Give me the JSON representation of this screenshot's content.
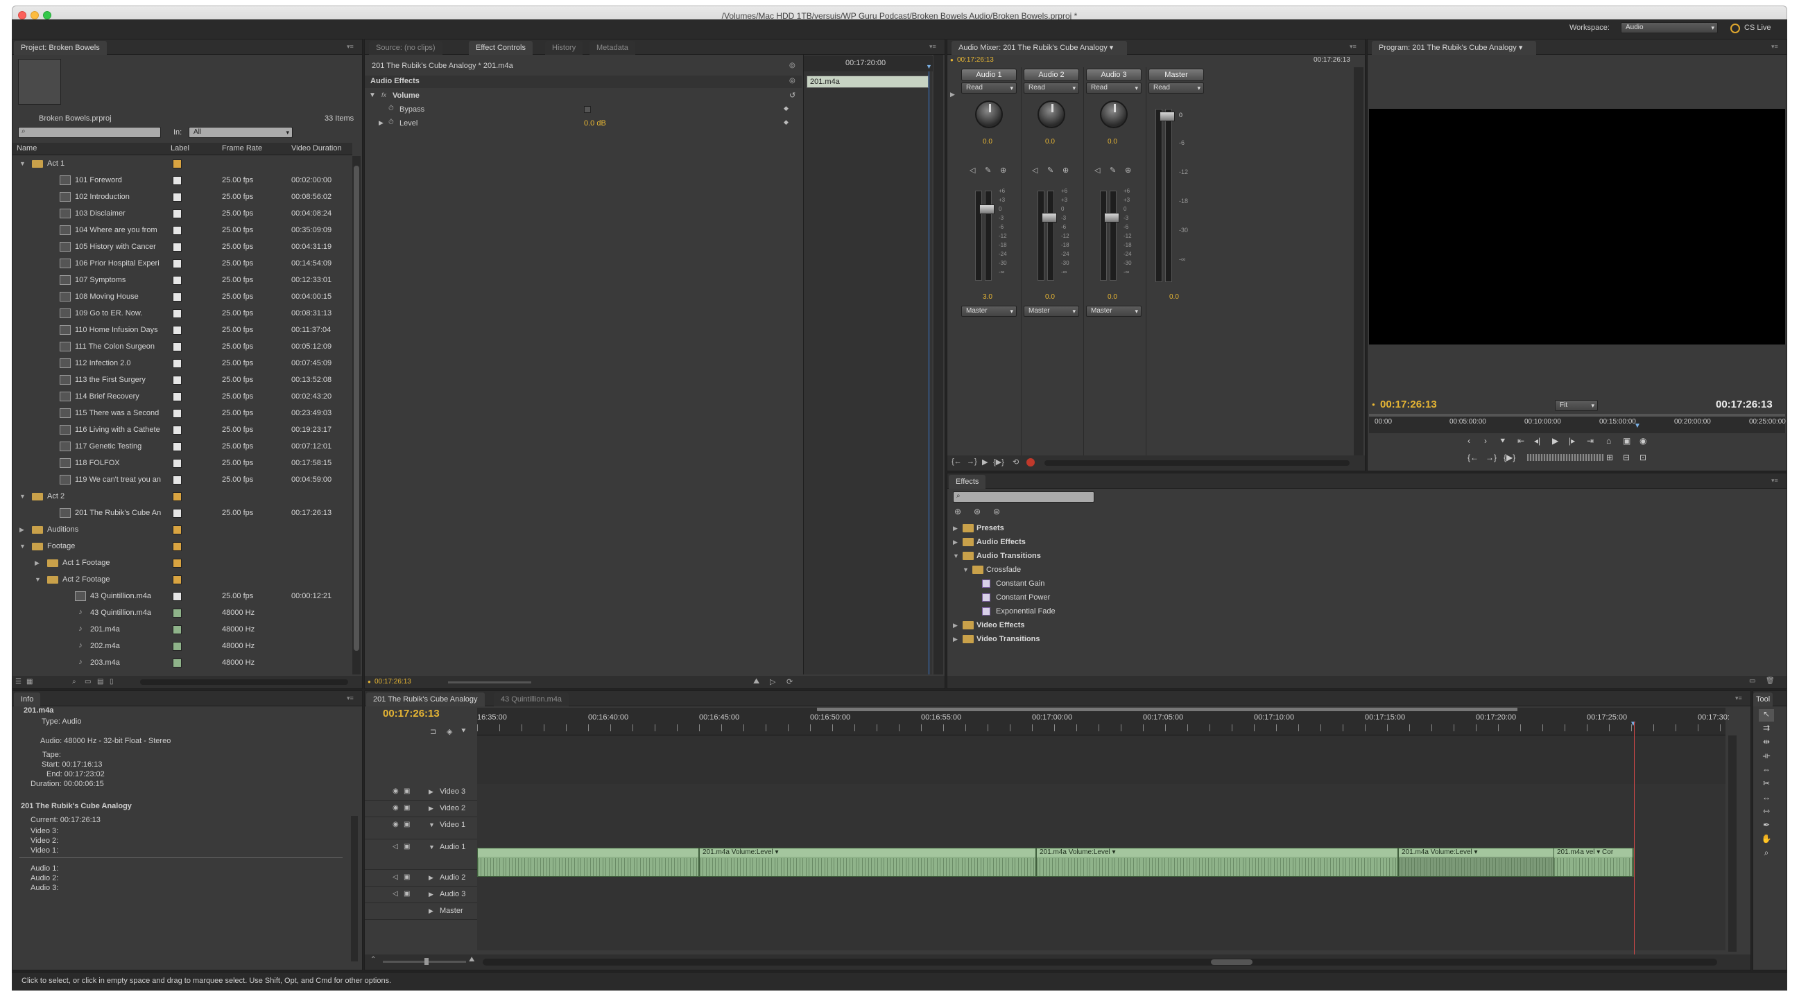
{
  "window": {
    "title": "/Volumes/Mac HDD 1TB/versuis/WP Guru Podcast/Broken Bowels Audio/Broken Bowels.prproj *"
  },
  "workspace": {
    "label": "Workspace:",
    "value": "Audio",
    "cs_live": "CS Live"
  },
  "project": {
    "tab": "Project: Broken Bowels",
    "filename": "Broken Bowels.prproj",
    "items_count": "33 Items",
    "in_label": "In:",
    "in_value": "All",
    "columns": [
      "Name",
      "Label",
      "Frame Rate",
      "Video Duration"
    ],
    "rows": [
      {
        "name": "Act 1",
        "type": "folder",
        "indent": 0,
        "twirl": "open",
        "label": "#d9a441",
        "fps": "",
        "dur": ""
      },
      {
        "name": "101 Foreword",
        "type": "seq",
        "indent": 1,
        "label": "#e6e6e6",
        "fps": "25.00 fps",
        "dur": "00:02:00:00"
      },
      {
        "name": "102 Introduction",
        "type": "seq",
        "indent": 1,
        "label": "#e6e6e6",
        "fps": "25.00 fps",
        "dur": "00:08:56:02"
      },
      {
        "name": "103 Disclaimer",
        "type": "seq",
        "indent": 1,
        "label": "#e6e6e6",
        "fps": "25.00 fps",
        "dur": "00:04:08:24"
      },
      {
        "name": "104 Where are you from",
        "type": "seq",
        "indent": 1,
        "label": "#e6e6e6",
        "fps": "25.00 fps",
        "dur": "00:35:09:09"
      },
      {
        "name": "105 History with Cancer",
        "type": "seq",
        "indent": 1,
        "label": "#e6e6e6",
        "fps": "25.00 fps",
        "dur": "00:04:31:19"
      },
      {
        "name": "106 Prior Hospital Experi",
        "type": "seq",
        "indent": 1,
        "label": "#e6e6e6",
        "fps": "25.00 fps",
        "dur": "00:14:54:09"
      },
      {
        "name": "107 Symptoms",
        "type": "seq",
        "indent": 1,
        "label": "#e6e6e6",
        "fps": "25.00 fps",
        "dur": "00:12:33:01"
      },
      {
        "name": "108 Moving House",
        "type": "seq",
        "indent": 1,
        "label": "#e6e6e6",
        "fps": "25.00 fps",
        "dur": "00:04:00:15"
      },
      {
        "name": "109 Go to ER. Now.",
        "type": "seq",
        "indent": 1,
        "label": "#e6e6e6",
        "fps": "25.00 fps",
        "dur": "00:08:31:13"
      },
      {
        "name": "110 Home Infusion Days",
        "type": "seq",
        "indent": 1,
        "label": "#e6e6e6",
        "fps": "25.00 fps",
        "dur": "00:11:37:04"
      },
      {
        "name": "111 The Colon Surgeon",
        "type": "seq",
        "indent": 1,
        "label": "#e6e6e6",
        "fps": "25.00 fps",
        "dur": "00:05:12:09"
      },
      {
        "name": "112 Infection 2.0",
        "type": "seq",
        "indent": 1,
        "label": "#e6e6e6",
        "fps": "25.00 fps",
        "dur": "00:07:45:09"
      },
      {
        "name": "113 the First Surgery",
        "type": "seq",
        "indent": 1,
        "label": "#e6e6e6",
        "fps": "25.00 fps",
        "dur": "00:13:52:08"
      },
      {
        "name": "114 Brief Recovery",
        "type": "seq",
        "indent": 1,
        "label": "#e6e6e6",
        "fps": "25.00 fps",
        "dur": "00:02:43:20"
      },
      {
        "name": "115 There was a Second",
        "type": "seq",
        "indent": 1,
        "label": "#e6e6e6",
        "fps": "25.00 fps",
        "dur": "00:23:49:03"
      },
      {
        "name": "116 Living with a Cathete",
        "type": "seq",
        "indent": 1,
        "label": "#e6e6e6",
        "fps": "25.00 fps",
        "dur": "00:19:23:17"
      },
      {
        "name": "117 Genetic Testing",
        "type": "seq",
        "indent": 1,
        "label": "#e6e6e6",
        "fps": "25.00 fps",
        "dur": "00:07:12:01"
      },
      {
        "name": "118 FOLFOX",
        "type": "seq",
        "indent": 1,
        "label": "#e6e6e6",
        "fps": "25.00 fps",
        "dur": "00:17:58:15"
      },
      {
        "name": "119 We can't treat you an",
        "type": "seq",
        "indent": 1,
        "label": "#e6e6e6",
        "fps": "25.00 fps",
        "dur": "00:04:59:00"
      },
      {
        "name": "Act 2",
        "type": "folder",
        "indent": 0,
        "twirl": "open",
        "label": "#d9a441",
        "fps": "",
        "dur": ""
      },
      {
        "name": "201 The Rubik's Cube An",
        "type": "seq",
        "indent": 1,
        "label": "#e6e6e6",
        "fps": "25.00 fps",
        "dur": "00:17:26:13"
      },
      {
        "name": "Auditions",
        "type": "folder",
        "indent": 0,
        "twirl": "closed",
        "label": "#d9a441",
        "fps": "",
        "dur": ""
      },
      {
        "name": "Footage",
        "type": "folder",
        "indent": 0,
        "twirl": "open",
        "label": "#d9a441",
        "fps": "",
        "dur": ""
      },
      {
        "name": "Act 1 Footage",
        "type": "folder",
        "indent": 1,
        "twirl": "closed",
        "label": "#d9a441",
        "fps": "",
        "dur": ""
      },
      {
        "name": "Act 2 Footage",
        "type": "folder",
        "indent": 1,
        "twirl": "open",
        "label": "#d9a441",
        "fps": "",
        "dur": ""
      },
      {
        "name": "43 Quintillion.m4a",
        "type": "seq",
        "indent": 2,
        "label": "#e6e6e6",
        "fps": "25.00 fps",
        "dur": "00:00:12:21"
      },
      {
        "name": "43 Quintillion.m4a",
        "type": "audio",
        "indent": 2,
        "label": "#8fb38a",
        "fps": "48000 Hz",
        "dur": ""
      },
      {
        "name": "201.m4a",
        "type": "audio",
        "indent": 2,
        "label": "#8fb38a",
        "fps": "48000 Hz",
        "dur": ""
      },
      {
        "name": "202.m4a",
        "type": "audio",
        "indent": 2,
        "label": "#8fb38a",
        "fps": "48000 Hz",
        "dur": ""
      },
      {
        "name": "203.m4a",
        "type": "audio",
        "indent": 2,
        "label": "#8fb38a",
        "fps": "48000 Hz",
        "dur": ""
      }
    ]
  },
  "effect_controls": {
    "tabs": [
      "Source: (no clips)",
      "Effect Controls",
      "History",
      "Metadata"
    ],
    "clip_title": "201 The Rubik's Cube Analogy * 201.m4a",
    "section": "Audio Effects",
    "effect": "Volume",
    "fx_badge": "fx",
    "params": [
      {
        "name": "Bypass",
        "value": ""
      },
      {
        "name": "Level",
        "value": "0.0 dB"
      }
    ],
    "mini_timecode": "00:17:20:00",
    "mini_clip": "201.m4a",
    "footer_timecode": "00:17:26:13"
  },
  "audio_mixer": {
    "tab": "Audio Mixer: 201 The Rubik's Cube Analogy",
    "timecode_left": "00:17:26:13",
    "timecode_right": "00:17:26:13",
    "channels": [
      {
        "name": "Audio 1",
        "mode": "Read",
        "pan": "0.0",
        "volume": "3.0",
        "output": "Master"
      },
      {
        "name": "Audio 2",
        "mode": "Read",
        "pan": "0.0",
        "volume": "0.0",
        "output": "Master"
      },
      {
        "name": "Audio 3",
        "mode": "Read",
        "pan": "0.0",
        "volume": "0.0",
        "output": "Master"
      }
    ],
    "master": {
      "name": "Master",
      "mode": "Read",
      "volume": "0.0",
      "top_label": "0"
    },
    "scale": [
      "+6",
      "+3",
      "0",
      "-3",
      "-6",
      "-12",
      "-18",
      "-24",
      "-30",
      "-∞"
    ],
    "master_scale": [
      "-6",
      "-12",
      "-18",
      "-30",
      "-∞"
    ]
  },
  "program": {
    "tab": "Program: 201 The Rubik's Cube Analogy",
    "timecode_current": "00:17:26:13",
    "timecode_duration": "00:17:26:13",
    "fit": "Fit",
    "ruler": [
      "00:00",
      "00:05:00:00",
      "00:10:00:00",
      "00:15:00:00",
      "00:20:00:00",
      "00:25:00:00"
    ]
  },
  "effects_panel": {
    "tab": "Effects",
    "items": [
      {
        "label": "Presets",
        "indent": 0,
        "twirl": "closed",
        "icon": "folder",
        "bold": true
      },
      {
        "label": "Audio Effects",
        "indent": 0,
        "twirl": "closed",
        "icon": "folder",
        "bold": true
      },
      {
        "label": "Audio Transitions",
        "indent": 0,
        "twirl": "open",
        "icon": "folder",
        "bold": true
      },
      {
        "label": "Crossfade",
        "indent": 1,
        "twirl": "open",
        "icon": "folder",
        "bold": false
      },
      {
        "label": "Constant Gain",
        "indent": 2,
        "twirl": "",
        "icon": "transition",
        "bold": false
      },
      {
        "label": "Constant Power",
        "indent": 2,
        "twirl": "",
        "icon": "transition",
        "bold": false
      },
      {
        "label": "Exponential Fade",
        "indent": 2,
        "twirl": "",
        "icon": "transition",
        "bold": false
      },
      {
        "label": "Video Effects",
        "indent": 0,
        "twirl": "closed",
        "icon": "folder",
        "bold": true
      },
      {
        "label": "Video Transitions",
        "indent": 0,
        "twirl": "closed",
        "icon": "folder",
        "bold": true
      }
    ]
  },
  "info": {
    "tab": "Info",
    "clip_name": "201.m4a",
    "type": "Type: Audio",
    "audio": "Audio: 48000 Hz - 32-bit Float - Stereo",
    "tape": "Tape:",
    "start": "Start: 00:17:16:13",
    "end": "End: 00:17:23:02",
    "duration": "Duration: 00:00:06:15",
    "sequence": "201 The Rubik's Cube Analogy",
    "current": "Current: 00:17:26:13",
    "video_lines": [
      "Video 3:",
      "Video 2:",
      "Video 1:"
    ],
    "audio_lines": [
      "Audio 1:",
      "Audio 2:",
      "Audio 3:"
    ]
  },
  "timeline": {
    "tabs": [
      "201 The Rubik's Cube Analogy",
      "43 Quintillion.m4a"
    ],
    "timecode": "00:17:26:13",
    "ruler": [
      "16:35:00",
      "00:16:40:00",
      "00:16:45:00",
      "00:16:50:00",
      "00:16:55:00",
      "00:17:00:00",
      "00:17:05:00",
      "00:17:10:00",
      "00:17:15:00",
      "00:17:20:00",
      "00:17:25:00",
      "00:17:30:"
    ],
    "tracks": [
      "Video 3",
      "Video 2",
      "Video 1",
      "Audio 1",
      "Audio 2",
      "Audio 3",
      "Master"
    ],
    "clips": [
      {
        "label": "201.m4a  Volume:Level ▾"
      },
      {
        "label": "201.m4a  Volume:Level ▾"
      },
      {
        "label": "201.m4a  Volume:Level ▾"
      },
      {
        "label": "201.m4a  vel ▾  Cor"
      }
    ]
  },
  "tools": {
    "tab": "Tool"
  },
  "status_bar": "Click to select, or click in empty space and drag to marquee select. Use Shift, Opt, and Cmd for other options."
}
